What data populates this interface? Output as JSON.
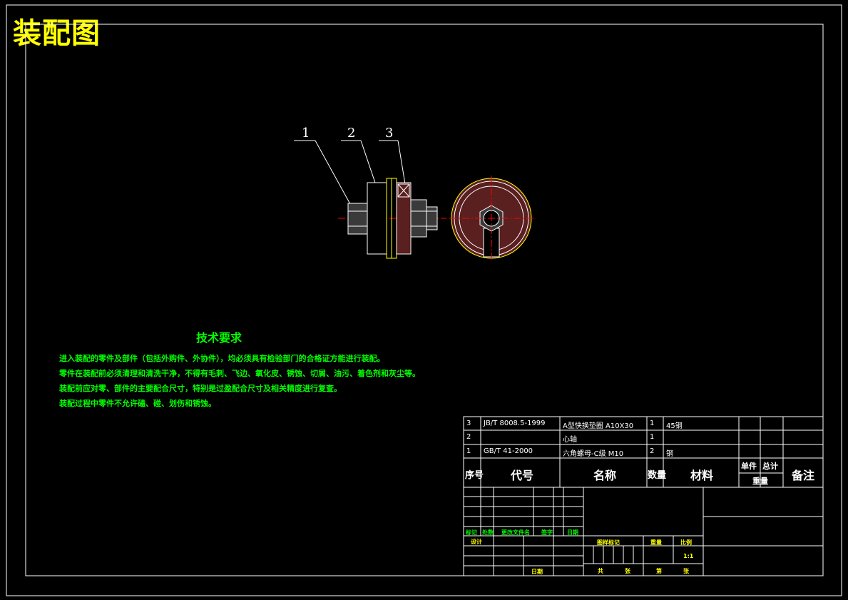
{
  "title": "装配图",
  "balloons": [
    "1",
    "2",
    "3"
  ],
  "technical_requirements": {
    "heading": "技术要求",
    "lines": [
      "进入装配的零件及部件（包括外购件、外协件），均必须具有检验部门的合格证方能进行装配。",
      "零件在装配前必须清理和清洗干净，不得有毛刺、飞边、氧化皮、锈蚀、切屑、油污、着色剂和灰尘等。",
      "装配前应对零、部件的主要配合尺寸，特别是过盈配合尺寸及相关精度进行复查。",
      "装配过程中零件不允许磕、碰、划伤和锈蚀。"
    ]
  },
  "bom": {
    "rows": [
      {
        "no": "3",
        "code": "JB/T 8008.5-1999",
        "name": "A型快换垫圈 A10X30",
        "qty": "1",
        "material": "45钢"
      },
      {
        "no": "2",
        "code": "",
        "name": "心轴",
        "qty": "1",
        "material": ""
      },
      {
        "no": "1",
        "code": "GB/T 41-2000",
        "name": "六角螺母-C级 M10",
        "qty": "2",
        "material": "钢"
      }
    ],
    "header": {
      "no": "序号",
      "code": "代号",
      "name": "名称",
      "qty": "数量",
      "material": "材料",
      "unit": "单件",
      "total": "总计",
      "weight": "重量",
      "remark": "备注"
    }
  },
  "title_block": {
    "revision_labels": [
      "标记",
      "处数",
      "更改文件名",
      "签字",
      "日期"
    ],
    "design": "设计",
    "approve": "日期",
    "stage_labels": [
      "图样标记",
      "重量",
      "比例"
    ],
    "scale": "1:1",
    "sheet_labels": [
      "共",
      "张",
      "第",
      "张"
    ]
  },
  "colors": {
    "background": "#000000",
    "frame": "#ffffff",
    "title": "#ffff00",
    "requirements": "#00ff00",
    "centerline": "#ff0000",
    "section_fill": "#5a1f1f",
    "washer": "#ffff00"
  }
}
